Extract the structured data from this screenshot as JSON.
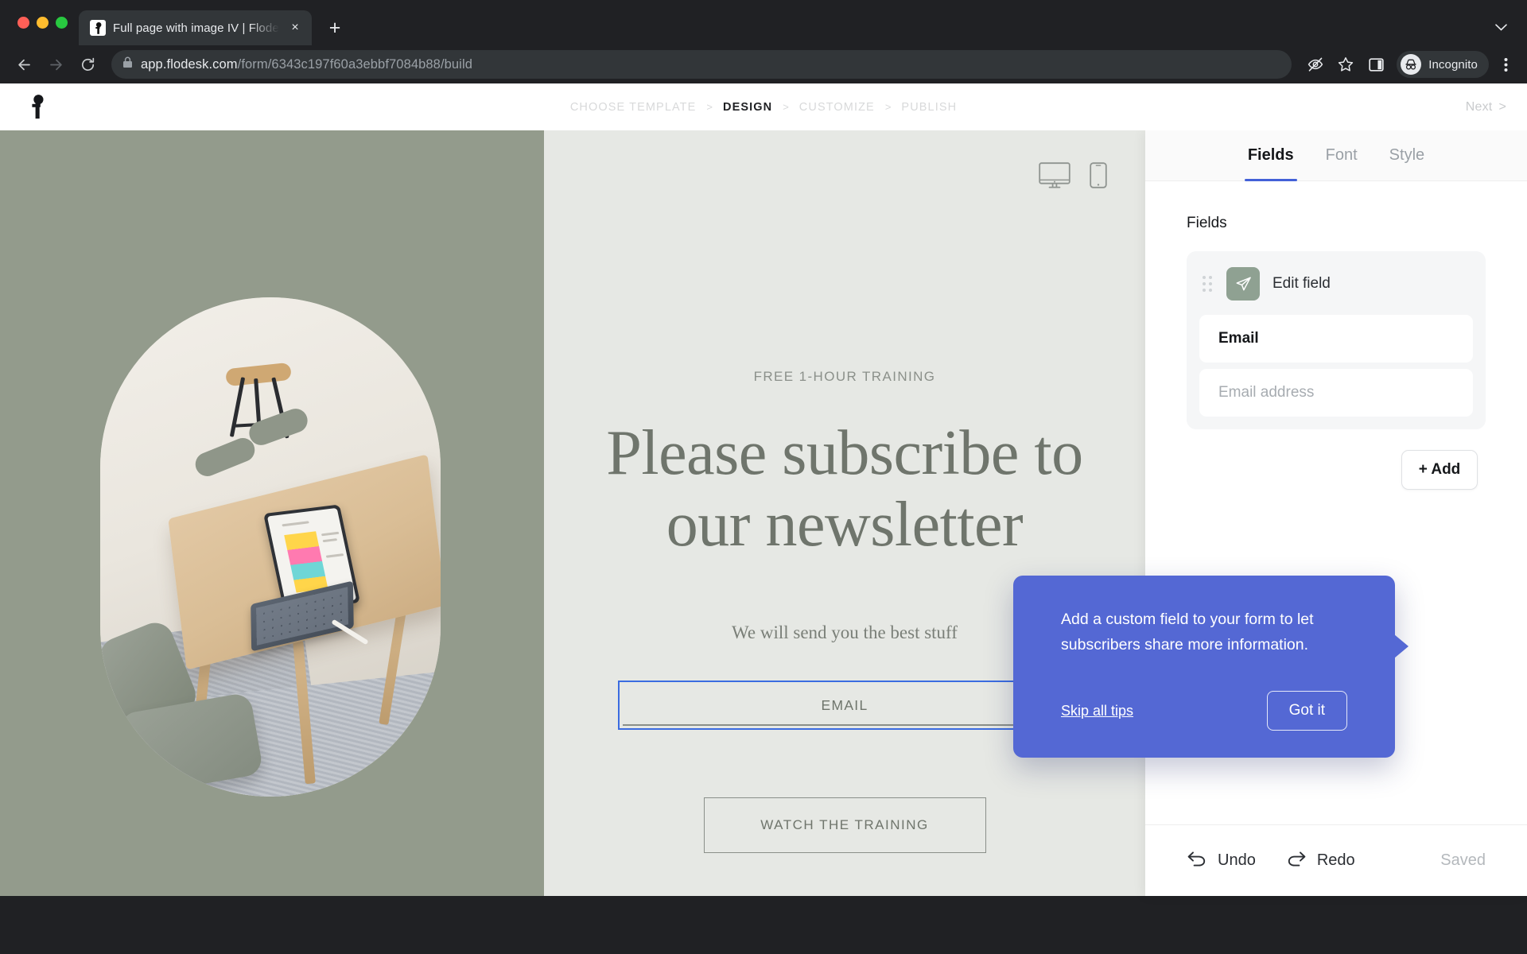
{
  "browser": {
    "tab": {
      "title": "Full page with image IV | Flodesk",
      "favicon": "flodesk-f-icon",
      "close": "×"
    },
    "new_tab_label": "+",
    "tab_list_icon": "chevron-down-icon",
    "nav": {
      "back": "back-arrow-icon",
      "forward": "forward-arrow-icon",
      "reload": "reload-icon"
    },
    "url": {
      "lock": "lock-icon",
      "host": "app.flodesk.com",
      "path": "/form/6343c197f60a3ebbf7084b88/build"
    },
    "toolbar": {
      "tracking_protection": "eye-slash-icon",
      "bookmark": "star-icon",
      "side_panel": "side-panel-icon",
      "profile_label": "Incognito",
      "menu": "kebab-menu-icon"
    }
  },
  "header": {
    "logo": "flodesk-logo",
    "steps": [
      {
        "label": "CHOOSE TEMPLATE",
        "active": false
      },
      {
        "label": "DESIGN",
        "active": true
      },
      {
        "label": "CUSTOMIZE",
        "active": false
      },
      {
        "label": "PUBLISH",
        "active": false
      }
    ],
    "separator": ">",
    "next_label": "Next",
    "next_chevron": ">"
  },
  "canvas": {
    "device_toggle": {
      "desktop": "desktop-monitor-icon",
      "mobile": "mobile-phone-icon"
    },
    "form": {
      "eyebrow": "FREE 1-HOUR TRAINING",
      "headline": "Please subscribe to our newsletter",
      "subtext": "We will send you the best stuff",
      "email_field_label": "EMAIL",
      "cta_label": "WATCH THE TRAINING"
    },
    "cursor": "pointer-hand-cursor"
  },
  "right_panel": {
    "tabs": [
      {
        "label": "Fields",
        "active": true
      },
      {
        "label": "Font",
        "active": false
      },
      {
        "label": "Style",
        "active": false
      }
    ],
    "section_title": "Fields",
    "field_card": {
      "drag_handle": "drag-handle-icon",
      "icon": "paper-plane-icon",
      "icon_color": "#8fa192",
      "edit_label": "Edit field",
      "name_value": "Email",
      "placeholder_value": "Email address"
    },
    "add_button": "+ Add",
    "footer": {
      "undo_label": "Undo",
      "undo_icon": "undo-arrow-icon",
      "redo_label": "Redo",
      "redo_icon": "redo-arrow-icon",
      "status": "Saved"
    }
  },
  "tooltip": {
    "text": "Add a custom field to your form to let subscribers share more information.",
    "skip_label": "Skip all tips",
    "confirm_label": "Got it",
    "background": "#5468d4"
  }
}
